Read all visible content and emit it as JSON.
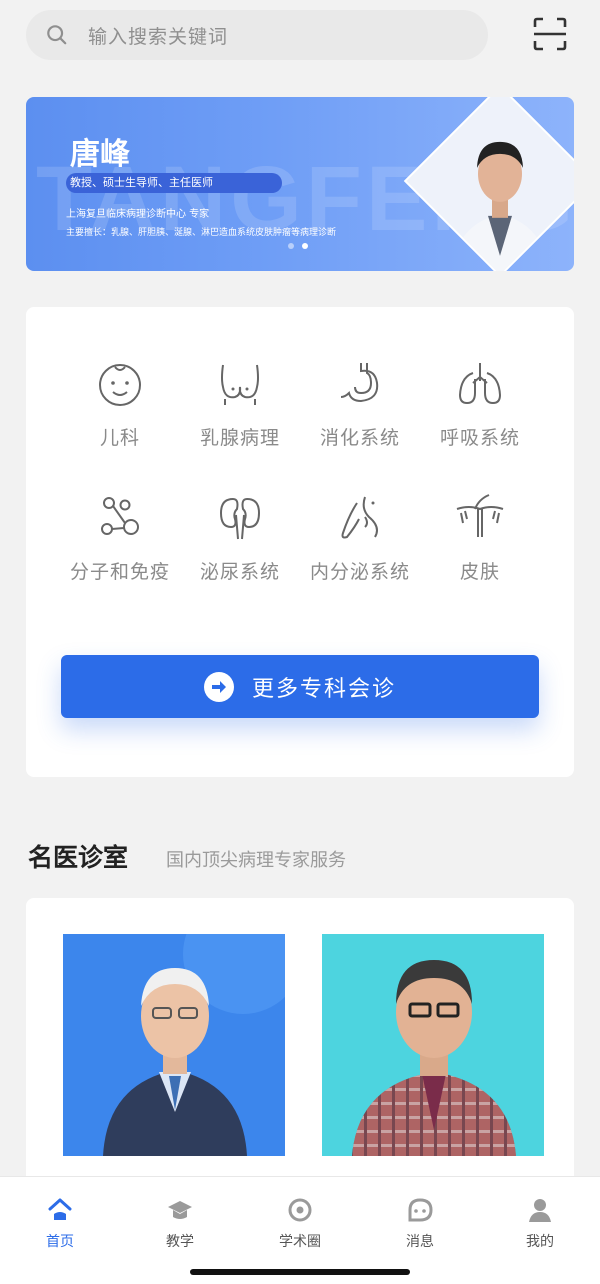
{
  "search": {
    "placeholder": "输入搜索关键词",
    "icon": "search-icon",
    "scan_icon": "scan-icon"
  },
  "banner": {
    "name": "唐峰",
    "bg_text": "TANGFENG",
    "title": "教授、硕士生导师、主任医师",
    "line1": "上海复旦临床病理诊断中心 专家",
    "line2": "主要擅长：乳腺、肝胆胰、涎腺、淋巴造血系统皮肤肿瘤等病理诊断",
    "signature": "唐峰",
    "slide_index": 2,
    "slide_total": 2
  },
  "departments": [
    {
      "label": "儿科",
      "icon": "baby-face-icon"
    },
    {
      "label": "乳腺病理",
      "icon": "breast-icon"
    },
    {
      "label": "消化系统",
      "icon": "stomach-icon"
    },
    {
      "label": "呼吸系统",
      "icon": "lungs-icon"
    },
    {
      "label": "分子和免疫",
      "icon": "molecule-icon"
    },
    {
      "label": "泌尿系统",
      "icon": "kidney-icon"
    },
    {
      "label": "内分泌系统",
      "icon": "thyroid-icon"
    },
    {
      "label": "皮肤",
      "icon": "skin-hair-icon"
    }
  ],
  "more_button": {
    "label": "更多专科会诊",
    "icon": "arrow-right-icon"
  },
  "section": {
    "title": "名医诊室",
    "subtitle": "国内顶尖病理专家服务"
  },
  "doctors": [
    {
      "photo": "doctor-portrait-1"
    },
    {
      "photo": "doctor-portrait-2"
    }
  ],
  "nav": [
    {
      "label": "首页",
      "icon": "home-icon",
      "active": true
    },
    {
      "label": "教学",
      "icon": "graduation-cap-icon",
      "active": false
    },
    {
      "label": "学术圈",
      "icon": "circle-icon",
      "active": false
    },
    {
      "label": "消息",
      "icon": "message-icon",
      "active": false
    },
    {
      "label": "我的",
      "icon": "user-icon",
      "active": false
    }
  ],
  "colors": {
    "accent": "#2c6ce8",
    "background": "#f2f2f2",
    "card": "#ffffff",
    "muted_text": "#8a8a8a"
  }
}
